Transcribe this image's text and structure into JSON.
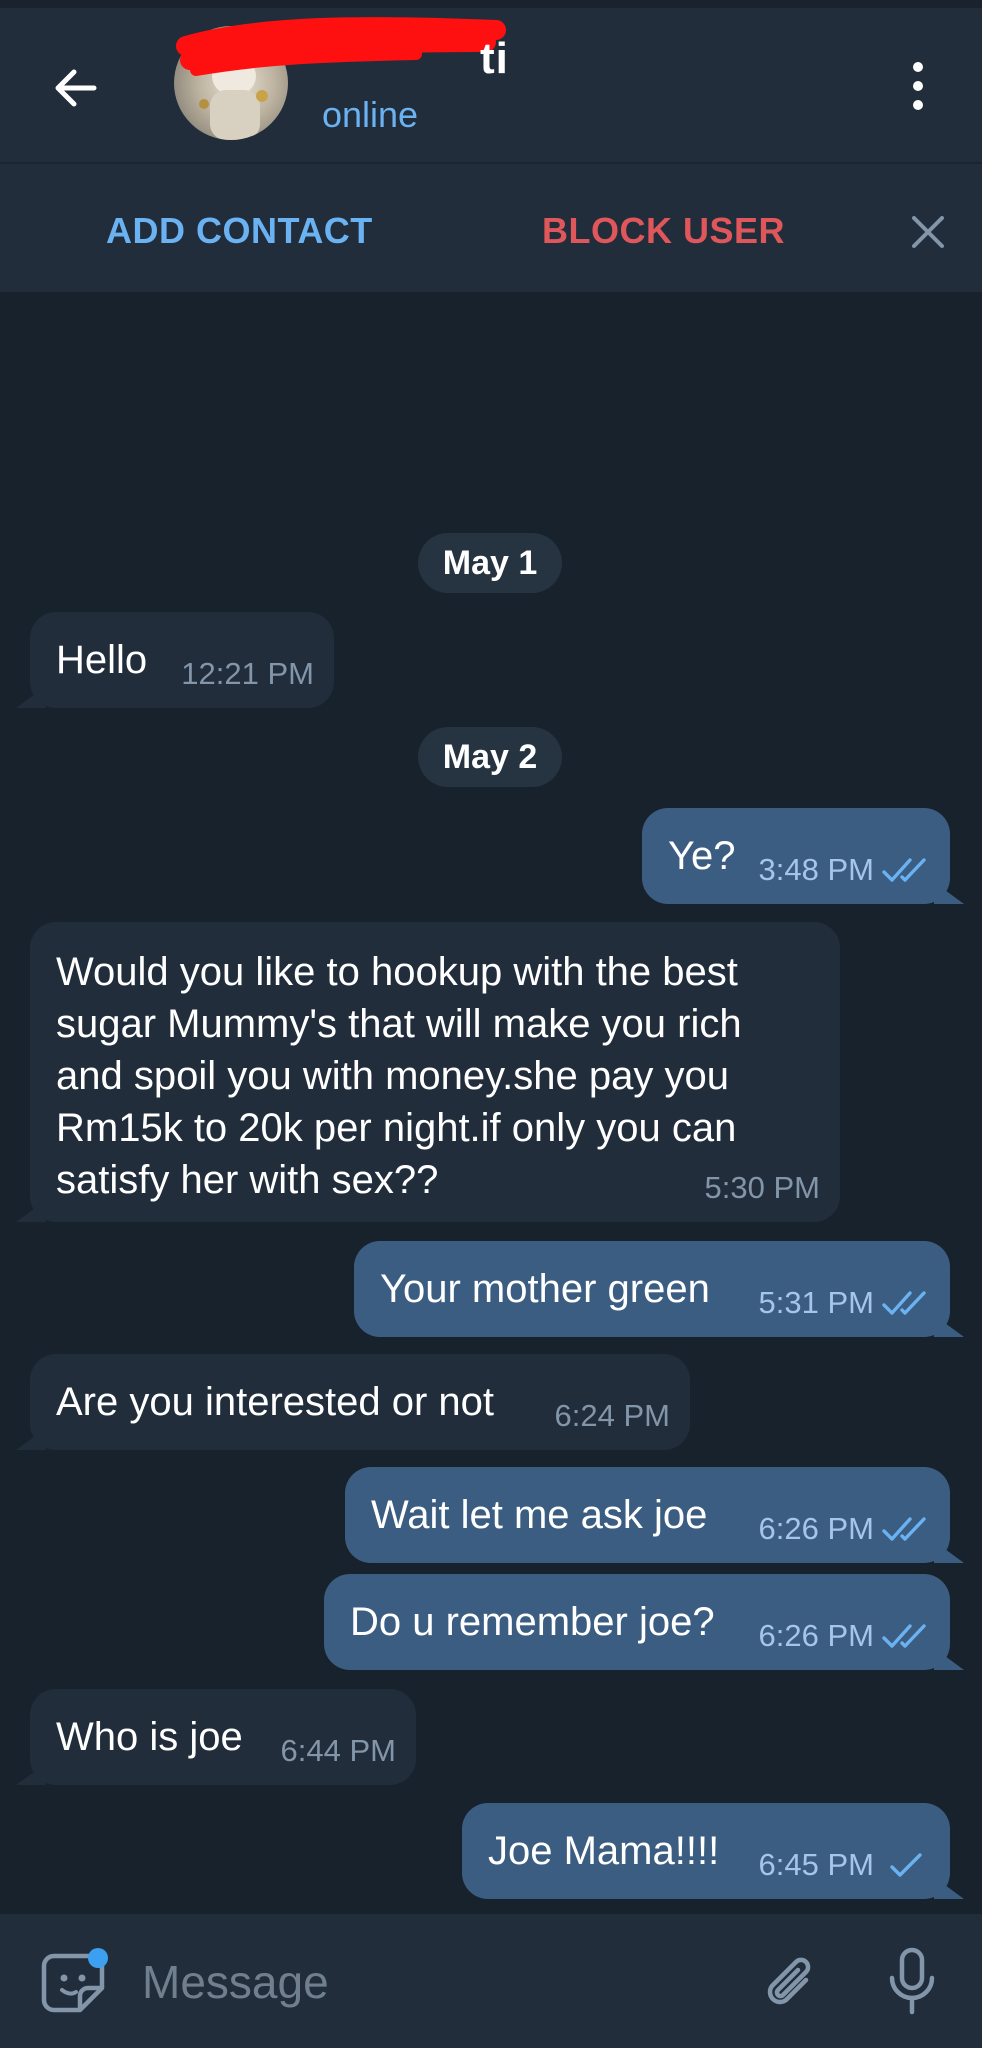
{
  "header": {
    "contact_name": "ti",
    "status": "online",
    "back_icon": "arrow-left-icon",
    "menu_icon": "more-vertical-icon"
  },
  "action_bar": {
    "add_contact_label": "ADD CONTACT",
    "block_user_label": "BLOCK USER",
    "close_icon": "close-icon"
  },
  "dates": [
    "May 1",
    "May 2"
  ],
  "messages": [
    {
      "direction": "incoming",
      "text": "Hello",
      "time": "12:21 PM"
    },
    {
      "direction": "outgoing",
      "text": "Ye?",
      "time": "3:48 PM",
      "status": "read"
    },
    {
      "direction": "incoming",
      "text": "Would you like to hookup with the best\nsugar Mummy's that will make you rich\nand spoil you with money.she pay you\nRm15k to 20k per night.if only you can\nsatisfy her with sex??",
      "time": "5:30 PM"
    },
    {
      "direction": "outgoing",
      "text": "Your mother green",
      "time": "5:31 PM",
      "status": "read"
    },
    {
      "direction": "incoming",
      "text": "Are you interested or not",
      "time": "6:24 PM"
    },
    {
      "direction": "outgoing",
      "text": "Wait let me ask joe",
      "time": "6:26 PM",
      "status": "read"
    },
    {
      "direction": "outgoing",
      "text": "Do u remember joe?",
      "time": "6:26 PM",
      "status": "read"
    },
    {
      "direction": "incoming",
      "text": "Who is joe",
      "time": "6:44 PM"
    },
    {
      "direction": "outgoing",
      "text": "Joe Mama!!!!",
      "time": "6:45 PM",
      "status": "sent"
    }
  ],
  "composer": {
    "placeholder": "Message",
    "sticker_icon": "sticker-icon",
    "attach_icon": "paperclip-icon",
    "mic_icon": "microphone-icon"
  },
  "colors": {
    "background": "#18222d",
    "bar": "#212d3b",
    "incoming_bubble": "#212d3b",
    "outgoing_bubble": "#3c5d82",
    "accent_blue": "#6ab2f2",
    "danger_red": "#e0575b"
  }
}
